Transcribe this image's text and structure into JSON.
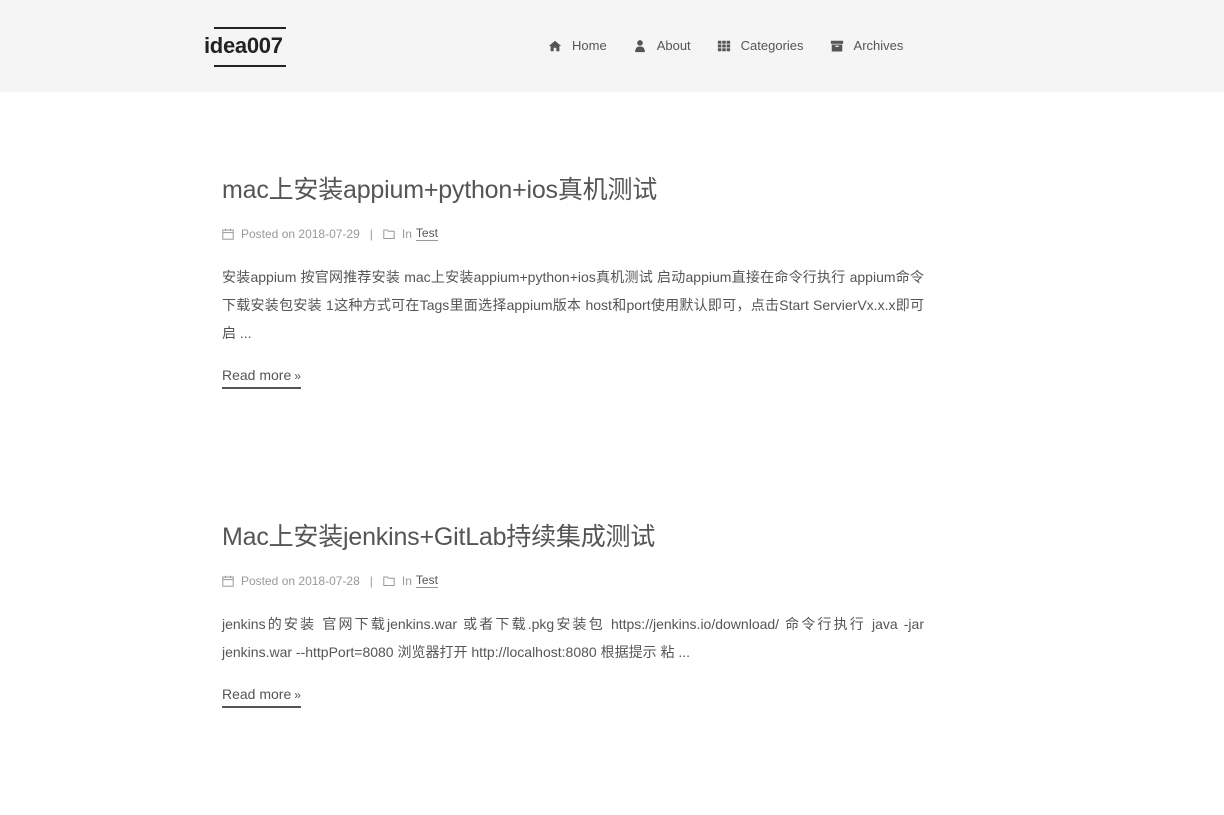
{
  "site": {
    "brand": "idea007"
  },
  "nav": {
    "items": [
      {
        "label": "Home",
        "icon": "home-icon"
      },
      {
        "label": "About",
        "icon": "user-icon"
      },
      {
        "label": "Categories",
        "icon": "th-icon"
      },
      {
        "label": "Archives",
        "icon": "archive-icon"
      }
    ]
  },
  "posts": [
    {
      "title": "mac上安装appium+python+ios真机测试",
      "posted_label": "Posted on",
      "date": "2018-07-29",
      "in_label": "In",
      "category": "Test",
      "excerpt": "安装appium 按官网推荐安装 mac上安装appium+python+ios真机测试 启动appium直接在命令行执行 appium命令 下载安装包安装 1这种方式可在Tags里面选择appium版本 host和port使用默认即可，点击Start ServierVx.x.x即可启 ...",
      "read_more": "Read more"
    },
    {
      "title": "Mac上安装jenkins+GitLab持续集成测试",
      "posted_label": "Posted on",
      "date": "2018-07-28",
      "in_label": "In",
      "category": "Test",
      "excerpt": "jenkins的安装 官网下载jenkins.war 或者下载.pkg安装包 https://jenkins.io/download/ 命令行执行 java -jar jenkins.war --httpPort=8080 浏览器打开 http://localhost:8080 根据提示 粘 ...",
      "read_more": "Read more"
    }
  ]
}
